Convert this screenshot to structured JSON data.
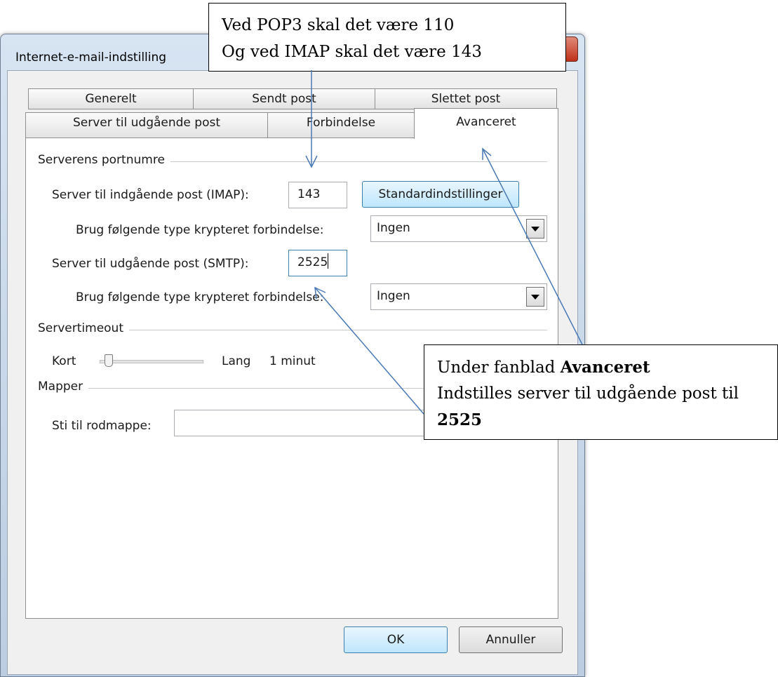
{
  "window": {
    "title": "Internet-e-mail-indstilling"
  },
  "tabs": {
    "row1": [
      {
        "label": "Generelt"
      },
      {
        "label": "Sendt post"
      },
      {
        "label": "Slettet post"
      }
    ],
    "row2": [
      {
        "label": "Server til udgående post"
      },
      {
        "label": "Forbindelse"
      },
      {
        "label": "Avanceret",
        "active": true
      }
    ]
  },
  "ports_group": {
    "title": "Serverens portnumre",
    "incoming_label": "Server til indgående post (IMAP):",
    "incoming_value": "143",
    "defaults_button": "Standardindstillinger",
    "incoming_encryption_label": "Brug følgende type krypteret forbindelse:",
    "incoming_encryption_value": "Ingen",
    "outgoing_label": "Server til udgående post (SMTP):",
    "outgoing_value": "2525",
    "outgoing_encryption_label": "Brug følgende type krypteret forbindelse:",
    "outgoing_encryption_value": "Ingen"
  },
  "timeout_group": {
    "title": "Servertimeout",
    "short_label": "Kort",
    "long_label": "Lang",
    "value_text": "1 minut",
    "slider_position": 0.05
  },
  "folders_group": {
    "title": "Mapper",
    "root_label": "Sti til rodmappe:",
    "root_value": ""
  },
  "footer": {
    "ok_label": "OK",
    "cancel_label": "Annuller"
  },
  "callouts": {
    "top": {
      "line1": "Ved POP3 skal det være 110",
      "line2": "Og ved IMAP skal det være 143"
    },
    "right": {
      "line1_prefix": "Under fanblad ",
      "line1_bold": "Avanceret",
      "line2": "Indstilles server til udgående post til",
      "line3_bold": "2525"
    }
  },
  "colors": {
    "arrow": "#4a7ab5",
    "accent": "#3c7fb1"
  }
}
